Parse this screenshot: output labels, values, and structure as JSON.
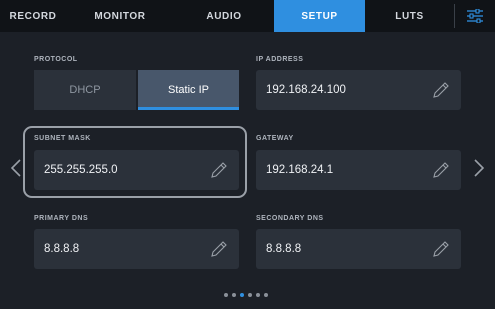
{
  "tabs": [
    {
      "label": "RECORD",
      "active": false
    },
    {
      "label": "MONITOR",
      "active": false
    },
    {
      "label": "AUDIO",
      "active": false
    },
    {
      "label": "SETUP",
      "active": true
    },
    {
      "label": "LUTS",
      "active": false
    }
  ],
  "menu_icon": "sliders-icon",
  "protocol": {
    "label": "PROTOCOL",
    "options": [
      "DHCP",
      "Static IP"
    ],
    "selected": "Static IP"
  },
  "ip_address": {
    "label": "IP ADDRESS",
    "value": "192.168.24.100"
  },
  "subnet_mask": {
    "label": "SUBNET MASK",
    "value": "255.255.255.0"
  },
  "gateway": {
    "label": "GATEWAY",
    "value": "192.168.24.1"
  },
  "primary_dns": {
    "label": "PRIMARY DNS",
    "value": "8.8.8.8"
  },
  "secondary_dns": {
    "label": "SECONDARY DNS",
    "value": "8.8.8.8"
  },
  "edit_icon": "pencil-icon",
  "pagination": {
    "pages": 6,
    "current": 3
  },
  "colors": {
    "accent": "#2f8fe0",
    "background": "#1c2027",
    "field": "#2b313a",
    "tabbar": "#101317"
  }
}
